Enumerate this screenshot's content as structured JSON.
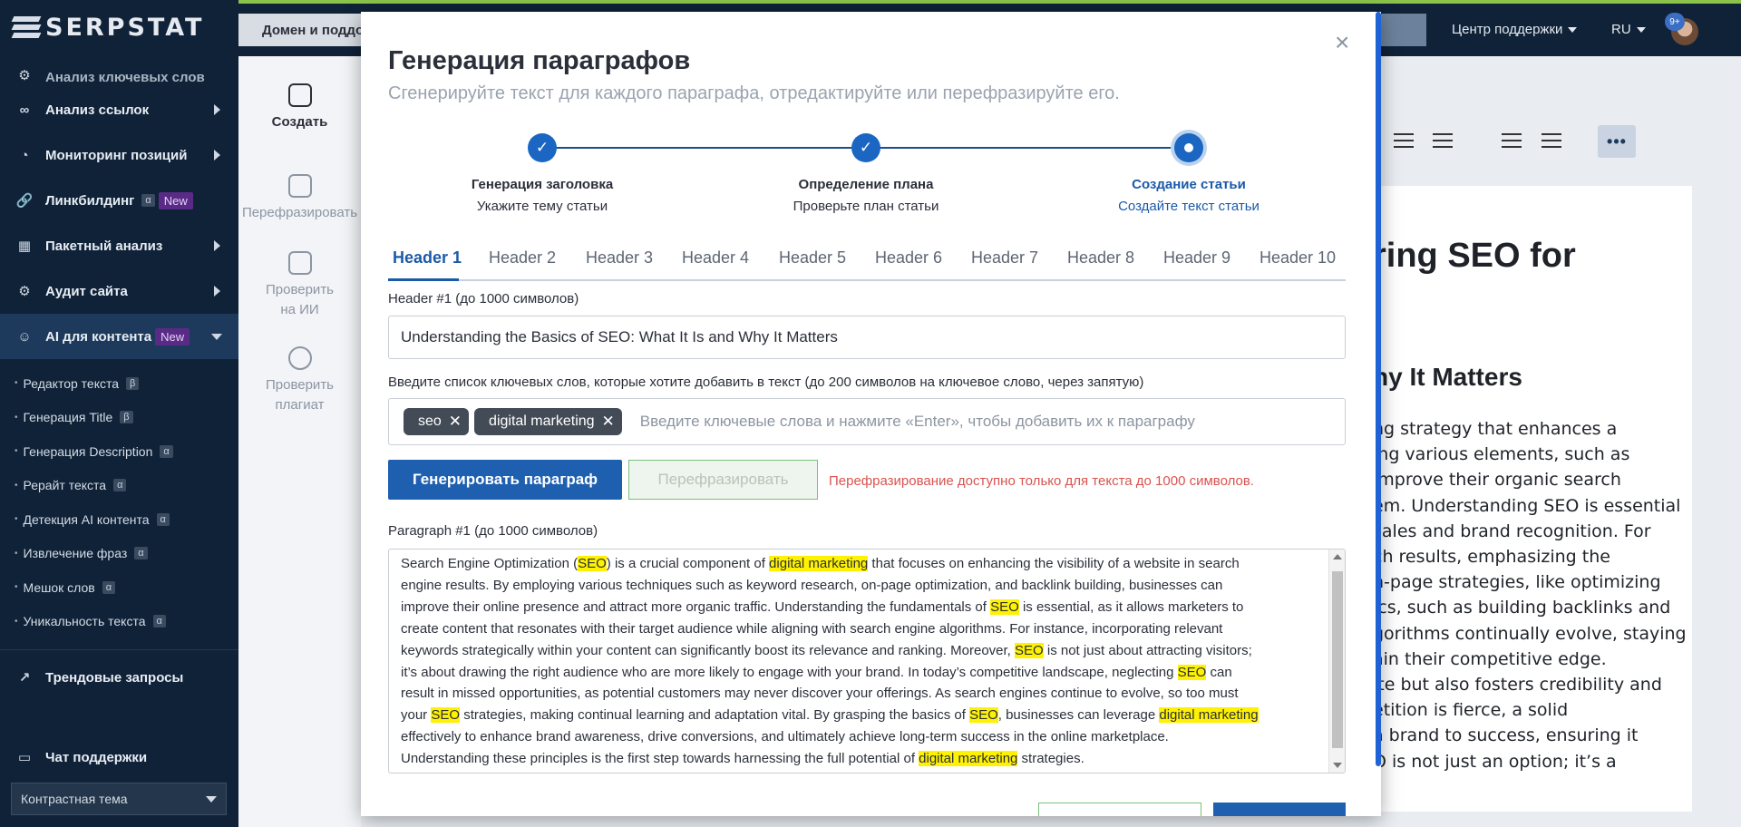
{
  "sidebar": {
    "logo": "SERPSTAT",
    "items": [
      {
        "label": "Анализ ключевых слов",
        "icon": "keyword-icon"
      },
      {
        "label": "Анализ ссылок",
        "icon": "link-icon"
      },
      {
        "label": "Мониторинг позиций",
        "icon": "rank-tracker-icon"
      },
      {
        "label": "Линкбилдинг",
        "icon": "linkbuilding-icon",
        "badge_a": "α",
        "badge_new": "New"
      },
      {
        "label": "Пакетный анализ",
        "icon": "batch-icon"
      },
      {
        "label": "Аудит сайта",
        "icon": "audit-gear-icon"
      },
      {
        "label": "AI для контента",
        "icon": "robot-icon",
        "badge_new": "New"
      }
    ],
    "sub_items": [
      {
        "label": "Редактор текста",
        "badge": "β"
      },
      {
        "label": "Генерация Title",
        "badge": "β"
      },
      {
        "label": "Генерация Description",
        "badge": "α"
      },
      {
        "label": "Рерайт текста",
        "badge": "α"
      },
      {
        "label": "Детекция AI контента",
        "badge": "α"
      },
      {
        "label": "Извлечение фраз",
        "badge": "α"
      },
      {
        "label": "Мешок слов",
        "badge": "α"
      },
      {
        "label": "Уникальность текста",
        "badge": "α"
      }
    ],
    "trends": "Трендовые запросы",
    "support_chat": "Чат поддержки",
    "theme": "Контрастная тема"
  },
  "topbar": {
    "domain_placeholder": "Домен и поддо",
    "support": "Центр поддержки",
    "lang": "RU",
    "notif_count": "9+"
  },
  "tools": {
    "create": "Создать",
    "paraphrase": "Перефразировать",
    "ai_check_1": "Проверить",
    "ai_check_2": "на ИИ",
    "plagiarism_1": "Проверить",
    "plagiarism_2": "плагиат"
  },
  "document": {
    "h1": "ring SEO for",
    "h2": "hy It Matters",
    "lines": [
      "ng strategy that enhances a",
      "ing various elements, such as",
      "improve their organic search",
      "em. Understanding SEO is essential",
      " sales and brand recognition. For",
      "ch results, emphasizing the",
      "n-page strategies, like optimizing",
      "ics, such as building backlinks and",
      "gorithms continually evolve, staying",
      "ain their competitive edge.",
      "ite but also fosters credibility and",
      "etition is fierce, a solid",
      "a brand to success, ensuring it",
      "O is not just an option; it’s a"
    ]
  },
  "modal": {
    "title": "Генерация параграфов",
    "subtitle": "Сгенерируйте текст для каждого параграфа, отредактируйте или перефразируйте его.",
    "close": "×",
    "steps": [
      {
        "label": "Генерация заголовка",
        "desc": "Укажите тему статьи",
        "state": "done"
      },
      {
        "label": "Определение плана",
        "desc": "Проверьте план статьи",
        "state": "done"
      },
      {
        "label": "Создание статьи",
        "desc": "Создайте текст статьи",
        "state": "current"
      }
    ],
    "tabs": [
      "Header 1",
      "Header 2",
      "Header 3",
      "Header 4",
      "Header 5",
      "Header 6",
      "Header 7",
      "Header 8",
      "Header 9",
      "Header 10"
    ],
    "header_label": "Header #1 (до 1000 символов)",
    "header_value": "Understanding the Basics of SEO: What It Is and Why It Matters",
    "keywords_label": "Введите список ключевых слов, которые хотите добавить в текст (до 200 символов на ключевое слово, через запятую)",
    "keywords": [
      "seo",
      "digital marketing"
    ],
    "keywords_placeholder": "Введите ключевые слова и нажмите «Enter», чтобы добавить их к параграфу",
    "generate_button": "Генерировать параграф",
    "paraphrase_button": "Перефразировать",
    "warning": "Перефразирование доступно только для текста до 1000 символов.",
    "paragraph_label": "Paragraph #1 (до 1000 символов)",
    "paragraph_lines": [
      [
        {
          "t": "Search Engine Optimization ("
        },
        {
          "t": "SEO",
          "h": true
        },
        {
          "t": ") is a crucial component of "
        },
        {
          "t": "digital marketing",
          "h": true
        },
        {
          "t": " that focuses on enhancing the visibility of a website in search"
        }
      ],
      [
        {
          "t": "engine results. By employing various techniques such as keyword research, on-page optimization, and backlink building, businesses can"
        }
      ],
      [
        {
          "t": "improve their online presence and attract more organic traffic. Understanding the fundamentals of "
        },
        {
          "t": "SEO",
          "h": true
        },
        {
          "t": " is essential, as it allows marketers to"
        }
      ],
      [
        {
          "t": "create content that resonates with their target audience while aligning with search engine algorithms. For instance, incorporating relevant"
        }
      ],
      [
        {
          "t": "keywords strategically within your content can significantly boost its relevance and ranking. Moreover, "
        },
        {
          "t": "SEO",
          "h": true
        },
        {
          "t": " is not just about attracting visitors;"
        }
      ],
      [
        {
          "t": "it’s about drawing the right audience who are more likely to engage with your brand. In today’s competitive landscape, neglecting "
        },
        {
          "t": "SEO",
          "h": true
        },
        {
          "t": " can"
        }
      ],
      [
        {
          "t": "result in missed opportunities, as potential customers may never discover your offerings. As search engines continue to evolve, so too must"
        }
      ],
      [
        {
          "t": "your "
        },
        {
          "t": "SEO",
          "h": true
        },
        {
          "t": " strategies, making continual learning and adaptation vital. By grasping the basics of "
        },
        {
          "t": "SEO",
          "h": true
        },
        {
          "t": ", businesses can leverage "
        },
        {
          "t": "digital marketing",
          "h": true
        }
      ],
      [
        {
          "t": "effectively to enhance brand awareness, drive conversions, and ultimately achieve long-term success in the online marketplace."
        }
      ],
      [
        {
          "t": "Understanding these principles is the first step towards harnessing the full potential of "
        },
        {
          "t": "digital marketing",
          "h": true
        },
        {
          "t": " strategies."
        }
      ]
    ]
  }
}
